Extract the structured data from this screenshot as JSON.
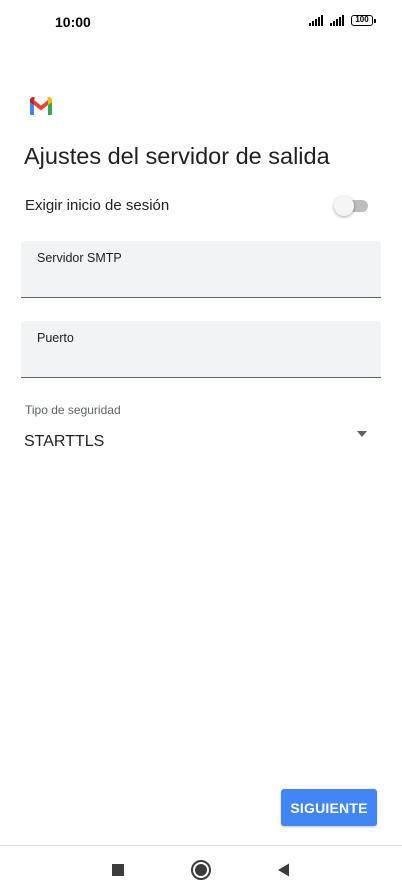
{
  "status_bar": {
    "time": "10:00",
    "battery": "100",
    "icons": [
      "signal-icon",
      "signal-icon",
      "battery-icon"
    ]
  },
  "app": {
    "logo": "gmail-logo",
    "title": "Ajustes del servidor de salida"
  },
  "require_login": {
    "label": "Exigir inicio de sesión",
    "enabled": false
  },
  "fields": {
    "smtp_server": {
      "label": "Servidor SMTP",
      "value": ""
    },
    "port": {
      "label": "Puerto",
      "value": ""
    }
  },
  "security": {
    "label": "Tipo de seguridad",
    "value": "STARTTLS"
  },
  "actions": {
    "next_label": "SIGUIENTE"
  },
  "colors": {
    "accent": "#4285f4",
    "field_bg": "#f1f3f4",
    "text": "#202124"
  },
  "nav_bar": {
    "icons": [
      "recents-square-icon",
      "home-circle-icon",
      "back-triangle-icon"
    ]
  }
}
